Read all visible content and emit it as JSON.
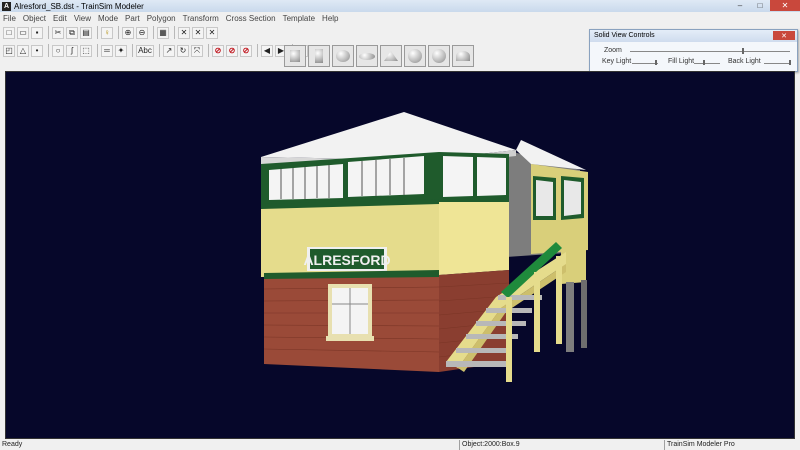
{
  "window": {
    "title": "Alresford_SB.dst - TrainSim Modeler",
    "icon_letter": "A"
  },
  "menu": [
    "File",
    "Object",
    "Edit",
    "View",
    "Mode",
    "Part",
    "Polygon",
    "Transform",
    "Cross Section",
    "Template",
    "Help"
  ],
  "toolbar1": {
    "icons": [
      "new-file-icon",
      "open-folder-icon",
      "save-icon",
      "cut-icon",
      "copy-icon",
      "paste-icon",
      "key-icon",
      "zoom-in-icon",
      "zoom-out-icon",
      "grid-icon",
      "mirror-x-icon",
      "mirror-y-icon",
      "mirror-z-icon"
    ],
    "glyphs": [
      "□",
      "▭",
      "▪",
      "✂",
      "⧉",
      "▤",
      "♀",
      "⊕",
      "⊖",
      "▦",
      "✕",
      "✕",
      "✕"
    ]
  },
  "toolbar2": {
    "icons": [
      "select-rect-icon",
      "triangle-icon",
      "point-icon",
      "circle-icon",
      "curve-icon",
      "box-select-icon",
      "bars-icon",
      "texture-icon",
      "text-abc-icon",
      "curve-arrow-icon",
      "rotate-icon",
      "scale-icon",
      "no-texture-icon",
      "no-lights-icon",
      "no-shade-icon",
      "prev-arrow-icon",
      "next-arrow-icon",
      "binoculars-icon"
    ],
    "glyphs": [
      "◰",
      "△",
      "•",
      "○",
      "ʃ",
      "⬚",
      "═",
      "✦",
      "Abc",
      "↗",
      "↻",
      "⤧",
      "⊘",
      "⊘",
      "⊘",
      "◀",
      "▶",
      "⚇"
    ]
  },
  "shapes": [
    "cube-shape-icon",
    "cylinder-shape-icon",
    "sphere-shape-icon",
    "ellipsoid-shape-icon",
    "cone-shape-icon",
    "textured-sphere-icon",
    "faceted-sphere-icon",
    "hemisphere-shape-icon"
  ],
  "solid_view_controls": {
    "title": "Solid View Controls",
    "close": "✕",
    "zoom_label": "Zoom",
    "key_light": "Key Light",
    "fill_light": "Fill Light",
    "back_light": "Back Light",
    "zoom_value": 0.7,
    "key_light_value": 0.9,
    "fill_light_value": 0.35,
    "back_light_value": 0.95
  },
  "scene": {
    "sign_text": "ALRESFORD",
    "colors": {
      "background": "#06072a",
      "roof": "#f2f2f2",
      "yellow": "#e5dc8c",
      "green": "#1f5b2c",
      "brick": "#9a4a38"
    }
  },
  "status": {
    "left": "Ready",
    "object": "Object:2000:Box.9",
    "product": "TrainSim Modeler Pro"
  }
}
